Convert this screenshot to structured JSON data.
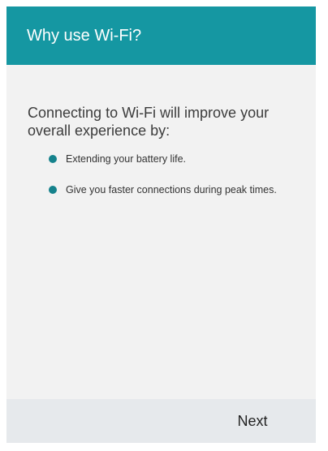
{
  "header": {
    "title": "Why use Wi-Fi?"
  },
  "main": {
    "intro": "Connecting to Wi-Fi will improve your overall experience by:",
    "bullets": [
      "Extending your battery life.",
      "Give you faster connections during peak times."
    ]
  },
  "footer": {
    "next_label": "Next"
  },
  "colors": {
    "header_bg": "#1597a2",
    "bullet_dot": "#15828c",
    "content_bg": "#f2f2f2",
    "footer_bg": "#e6e9ec"
  }
}
